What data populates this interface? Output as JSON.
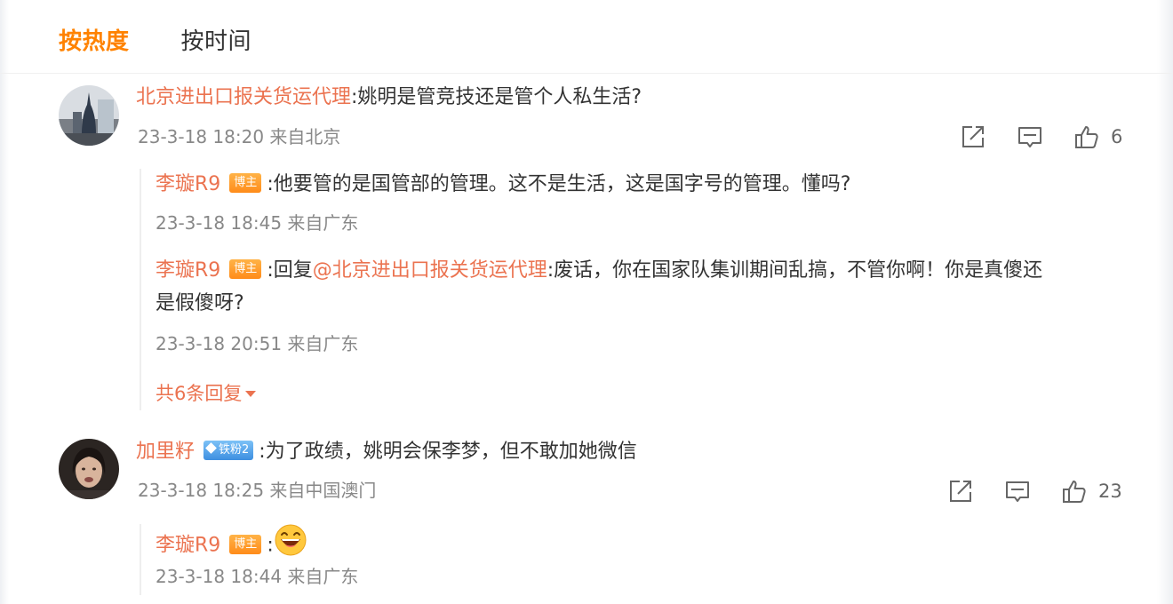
{
  "tabs": {
    "hot_label": "按热度",
    "time_label": "按时间"
  },
  "colors": {
    "accent": "#ff8200",
    "username": "#eb7350",
    "meta": "#888888"
  },
  "comments": [
    {
      "username": "北京进出口报关货运代理",
      "text": ":姚明是管竞技还是管个人私生活?",
      "meta": "23-3-18 18:20 来自北京",
      "like_count": "6",
      "replies": [
        {
          "username": "李璇R9",
          "badge": "博主",
          "text": ":他要管的是国管部的管理。这不是生活，这是国字号的管理。懂吗?",
          "meta": "23-3-18 18:45 来自广东"
        },
        {
          "username": "李璇R9",
          "badge": "博主",
          "reply_prefix": ":回复",
          "mention": "@北京进出口报关货运代理",
          "text_line1": ":废话，你在国家队集训期间乱搞，不管你啊！你是真傻还",
          "text_line2": "是假傻呀?",
          "meta": "23-3-18 20:51 来自广东"
        }
      ],
      "more_replies": "共6条回复"
    },
    {
      "username": "加里籽",
      "badge": "铁粉2",
      "text": ":为了政绩，姚明会保李梦，但不敢加她微信",
      "meta": "23-3-18 18:25 来自中国澳门",
      "like_count": "23",
      "replies": [
        {
          "username": "李璇R9",
          "badge": "博主",
          "text": ":",
          "emoji": "laughing-emoji",
          "meta": "23-3-18 18:44 来自广东"
        }
      ]
    }
  ],
  "icons": {
    "share": "share-icon",
    "comment": "comment-icon",
    "like": "thumbs-up-icon"
  }
}
